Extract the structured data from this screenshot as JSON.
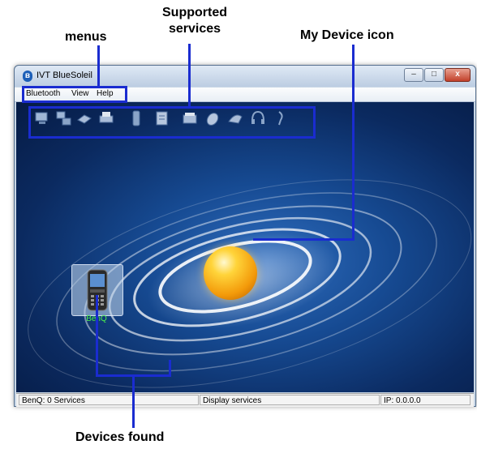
{
  "callouts": {
    "menus": "menus",
    "supported_services": [
      "Supported",
      "services"
    ],
    "my_device_icon": "My Device icon",
    "devices_found": "Devices found"
  },
  "window": {
    "title": "IVT BlueSoleil",
    "controls": {
      "minimize": "–",
      "maximize": "□",
      "close": "x"
    }
  },
  "menubar": {
    "items": [
      "Bluetooth",
      "View",
      "Help"
    ]
  },
  "services": [
    "network-service-icon",
    "lan-access-icon",
    "fax-icon",
    "printer-icon",
    "dial-up-icon",
    "file-transfer-icon",
    "sync-icon",
    "mouse-icon",
    "pim-icon",
    "headset-icon",
    "audio-gateway-icon"
  ],
  "device": {
    "name": "BenQ",
    "icon": "mobile-phone-icon",
    "label_color": "#4cf04c"
  },
  "status": {
    "left": "BenQ: 0 Services",
    "middle": "Display services",
    "right": "IP: 0.0.0.0"
  },
  "colors": {
    "callout_line": "#1a2cd0",
    "canvas_center": "#2f6dbe",
    "canvas_edge": "#061b44",
    "orb": "#f5a112"
  }
}
